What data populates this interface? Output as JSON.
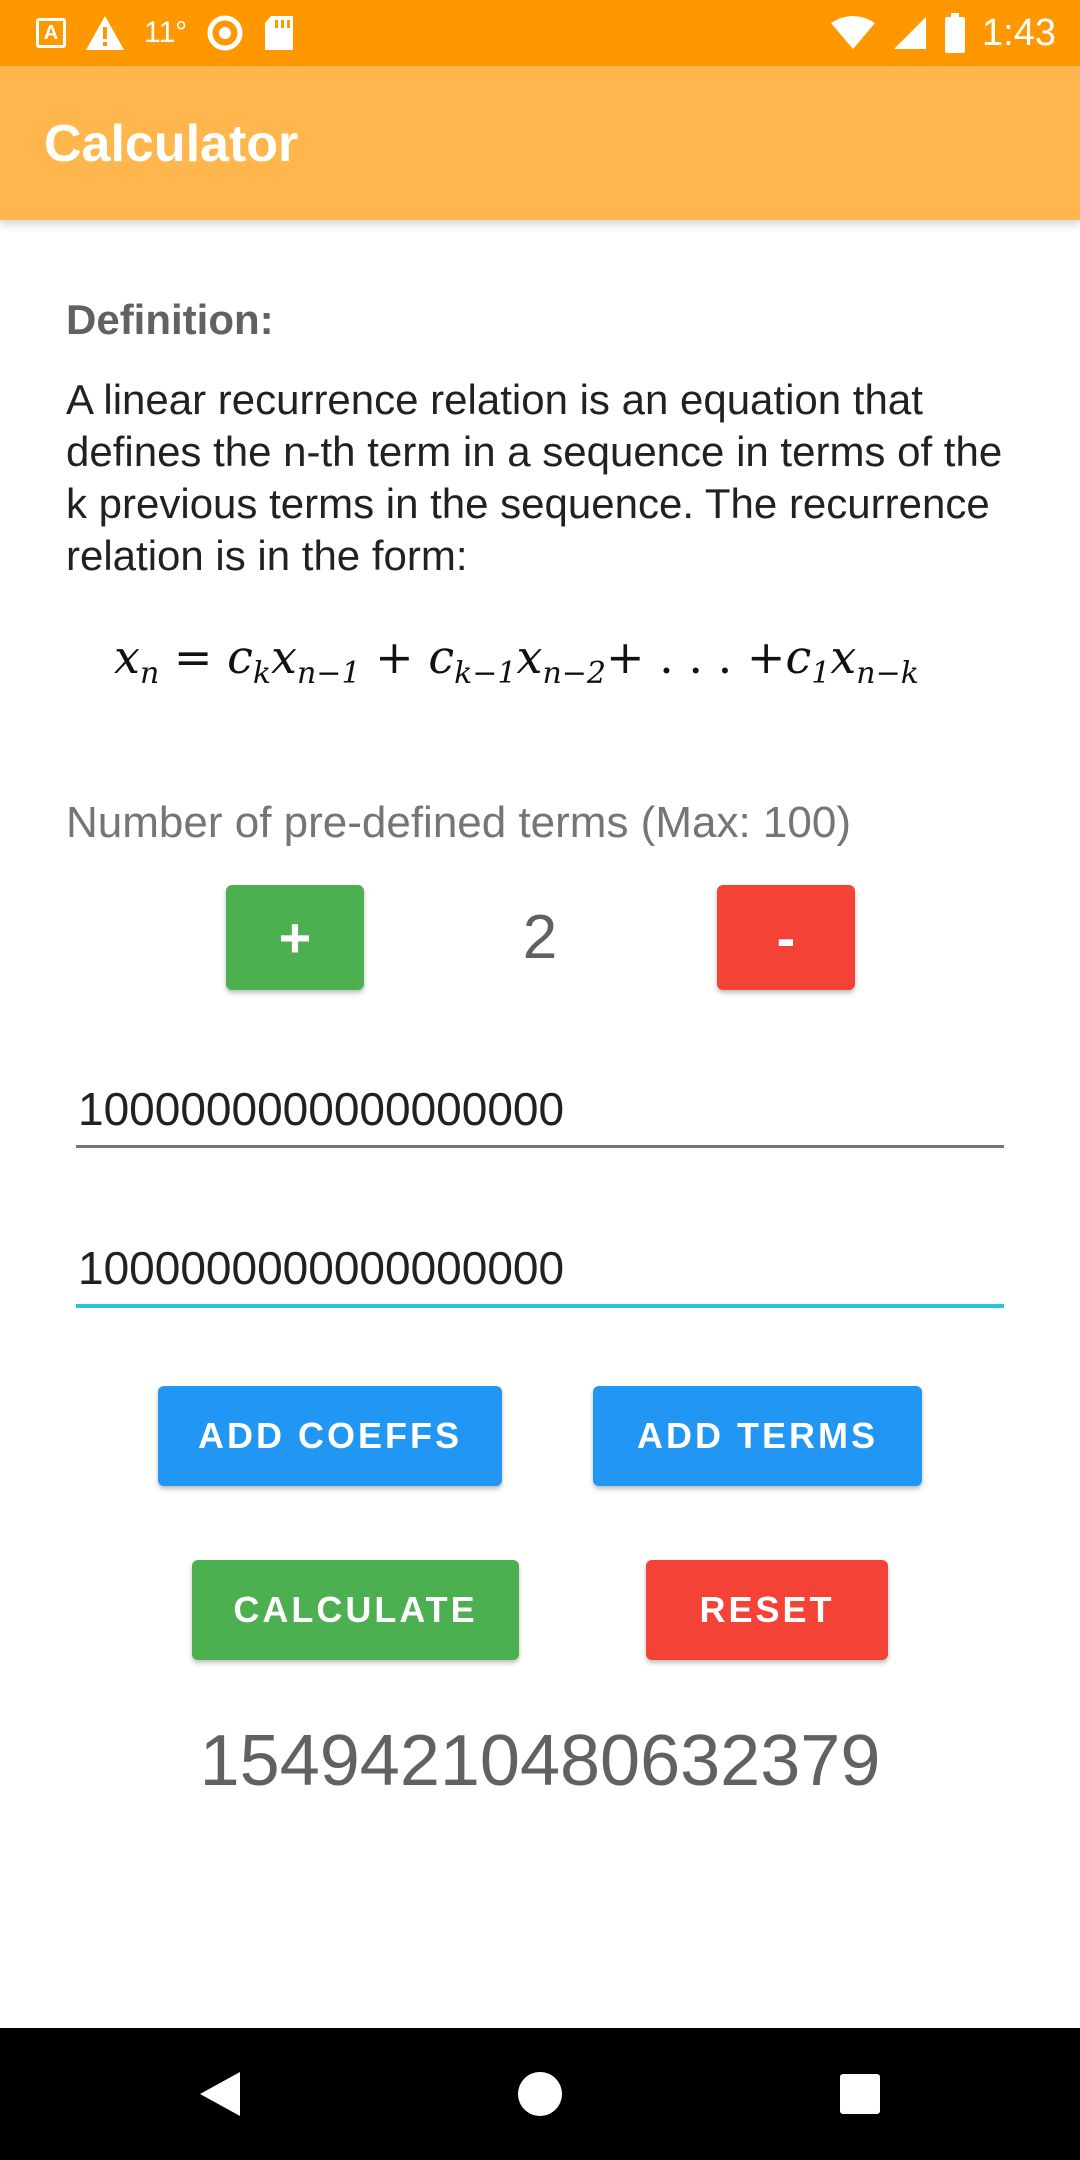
{
  "status_bar": {
    "temperature": "11°",
    "time": "1:43",
    "icons": [
      "a-box-icon",
      "warning-icon",
      "circle-icon",
      "sd-card-icon",
      "wifi-icon",
      "signal-icon",
      "battery-icon"
    ]
  },
  "app_bar": {
    "title": "Calculator"
  },
  "definition": {
    "label": "Definition:",
    "text": "A linear recurrence relation is an equation that defines the n-th term in a sequence in terms of the k previous terms in the sequence. The recurrence relation is in the form:"
  },
  "formula": {
    "lhs": "x",
    "lhs_sub": "n",
    "eq": " = ",
    "t1_c": "c",
    "t1_c_sub": "k",
    "t1_x": "x",
    "t1_x_sub": "n−1",
    "plus": " + ",
    "t2_c": "c",
    "t2_c_sub": "k−1",
    "t2_x": "x",
    "t2_x_sub": "n−2",
    "ellipsis": "+ . . . +",
    "t3_c": "c",
    "t3_c_sub": "1",
    "t3_x": "x",
    "t3_x_sub": "n−k"
  },
  "terms": {
    "label": "Number of pre-defined terms (Max: 100)",
    "plus_label": "+",
    "minus_label": "-",
    "count": "2"
  },
  "inputs": [
    {
      "value": "1000000000000000000"
    },
    {
      "value": "1000000000000000000"
    }
  ],
  "buttons": {
    "add_coeffs": "ADD COEFFS",
    "add_terms": "ADD TERMS",
    "calculate": "CALCULATE",
    "reset": "RESET"
  },
  "result": "15494210480632379",
  "colors": {
    "status_bar": "#FF9800",
    "app_bar": "#FFB74D",
    "green": "#4CAF50",
    "red": "#F44336",
    "blue": "#2196F3",
    "focus_underline": "#26C6DA"
  }
}
